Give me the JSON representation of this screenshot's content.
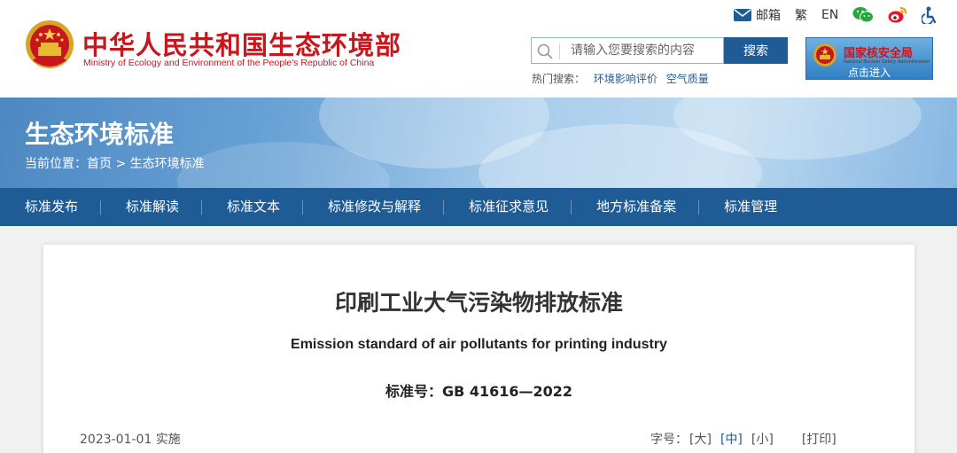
{
  "header": {
    "logo_cn": "中华人民共和国生态环境部",
    "logo_en": "Ministry of Ecology and Environment of the People's Republic of China",
    "links": {
      "mail": "邮箱",
      "traditional": "繁",
      "english": "EN"
    },
    "search": {
      "placeholder": "请输入您要搜索的内容",
      "button": "搜索"
    },
    "hot_search": {
      "label": "热门搜索：",
      "items": [
        "环境影响评价",
        "空气质量"
      ]
    },
    "nnsa": {
      "title": "国家核安全局",
      "subtitle": "National Nuclear Safety Administration",
      "enter": "点击进入"
    }
  },
  "banner": {
    "title": "生态环境标准",
    "breadcrumb": "当前位置：首页 > 生态环境标准"
  },
  "nav": {
    "items": [
      "标准发布",
      "标准解读",
      "标准文本",
      "标准修改与解释",
      "标准征求意见",
      "地方标准备案",
      "标准管理"
    ]
  },
  "document": {
    "title": "印刷工业大气污染物排放标准",
    "title_en": "Emission standard of air pollutants for printing industry",
    "code": "标准号：GB 41616—2022",
    "effective": "2023-01-01 实施",
    "font_size_label": "字号：",
    "font_sizes": [
      "[大]",
      "[中]",
      "[小]"
    ],
    "print": "[打印]"
  },
  "colors": {
    "brand_red": "#c8161d",
    "nav_blue": "#1f5b95"
  }
}
